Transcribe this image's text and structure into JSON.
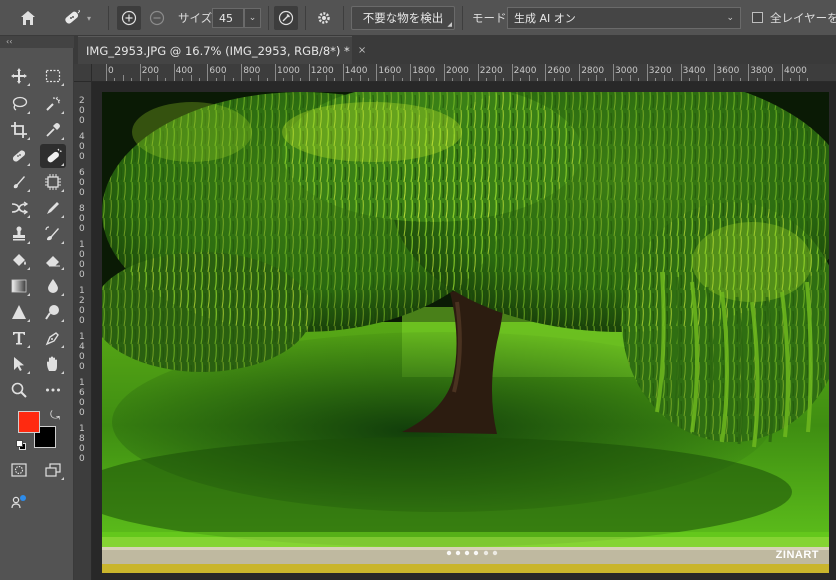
{
  "options_bar": {
    "home_icon": "home-icon",
    "tool_icon": "spot-healing-brush-icon",
    "size_label": "サイズ",
    "size_value": "45",
    "detect_button": "不要な物を検出",
    "mode_label": "モード",
    "mode_value": "生成 AI オン",
    "all_layers_label": "全レイヤーを対"
  },
  "document": {
    "tab_title": "IMG_2953.JPG @ 16.7% (IMG_2953, RGB/8*) *",
    "close_icon": "×"
  },
  "ruler": {
    "h_labels": [
      "0",
      "200",
      "400",
      "600",
      "800",
      "1000",
      "1200",
      "1400",
      "1600",
      "1800",
      "2000",
      "2200",
      "2400",
      "2600",
      "2800",
      "3000",
      "3200",
      "3400",
      "3600",
      "3800",
      "4000"
    ],
    "v_labels": [
      "2",
      "0",
      "0",
      "4",
      "0",
      "0",
      "6",
      "0",
      "0",
      "8",
      "0",
      "0",
      "1",
      "0",
      "0",
      "0",
      "1",
      "2",
      "0",
      "0",
      "1",
      "4",
      "0",
      "0",
      "1",
      "6",
      "0",
      "0",
      "1",
      "8",
      "0",
      "0"
    ]
  },
  "colors": {
    "foreground": "#ff2a10",
    "background": "#000000",
    "ui_bg": "#535353",
    "ui_dark": "#3a3a3a"
  },
  "watermark": "ZINART"
}
